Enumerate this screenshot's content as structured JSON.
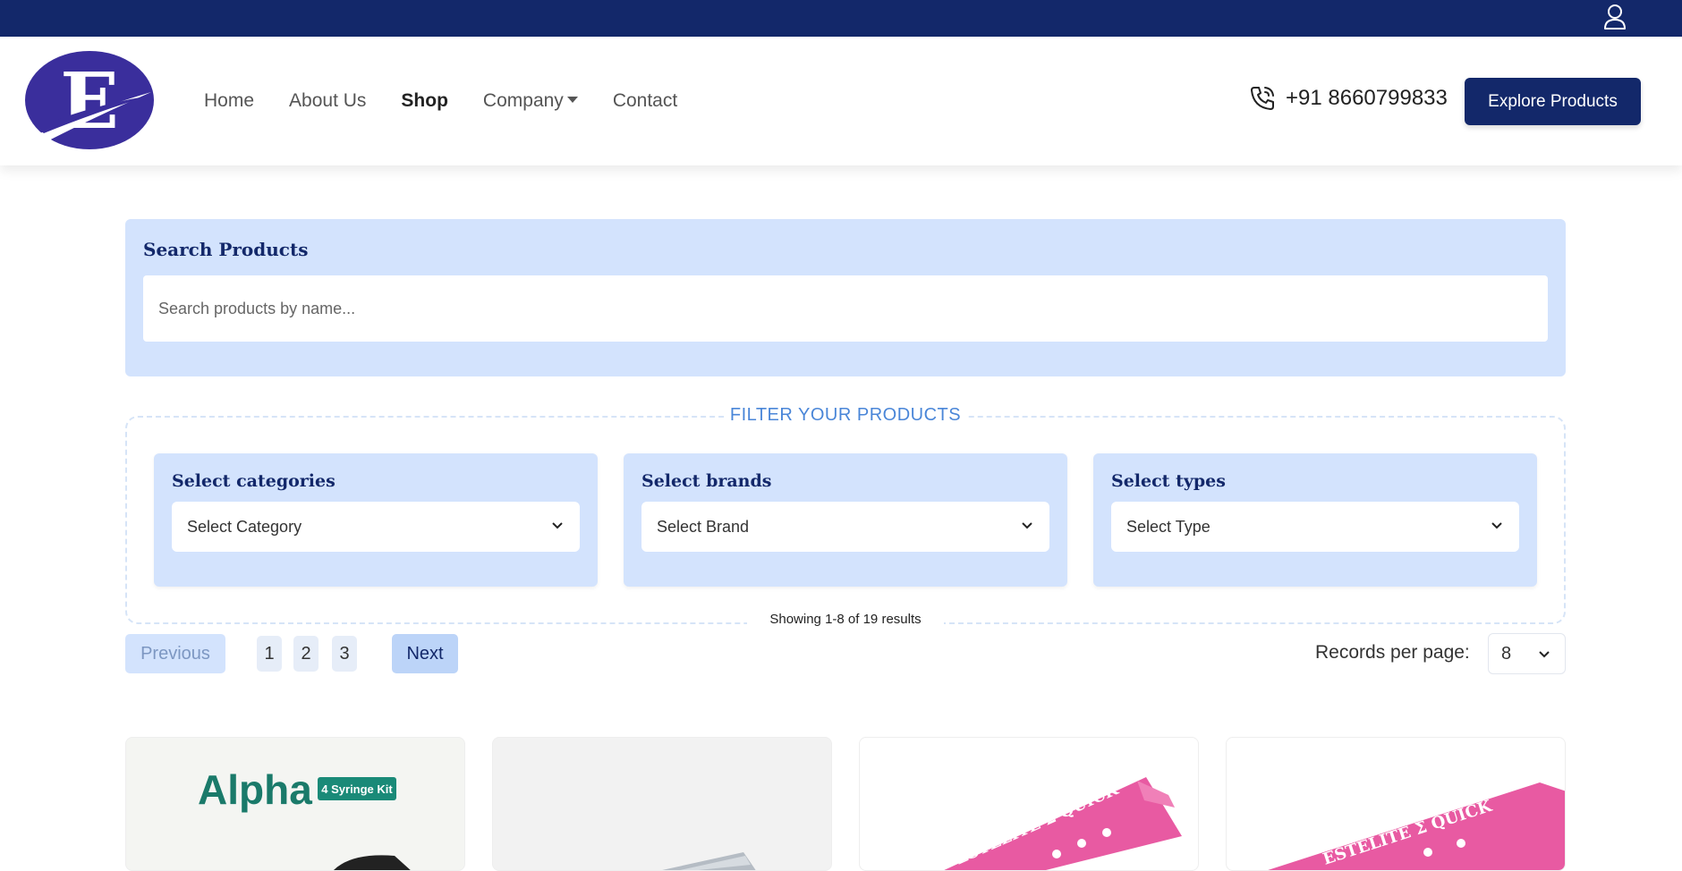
{
  "header": {
    "nav": [
      {
        "label": "Home"
      },
      {
        "label": "About Us"
      },
      {
        "label": "Shop",
        "active": true
      },
      {
        "label": "Company",
        "dropdown": true
      },
      {
        "label": "Contact"
      }
    ],
    "phone": "+91 8660799833",
    "explore_label": "Explore Products",
    "logo_letter": "E",
    "icons": {
      "user": "user-icon",
      "phone": "phone-icon",
      "logo": "brand-logo"
    }
  },
  "search": {
    "title": "Search Products",
    "placeholder": "Search products by name..."
  },
  "filters": {
    "heading": "FILTER YOUR PRODUCTS",
    "categories": {
      "label": "Select categories",
      "value": "Select Category"
    },
    "brands": {
      "label": "Select brands",
      "value": "Select Brand"
    },
    "types": {
      "label": "Select types",
      "value": "Select Type"
    },
    "showing": "Showing 1-8 of 19 results"
  },
  "pagination": {
    "previous": "Previous",
    "pages": [
      "1",
      "2",
      "3"
    ],
    "next": "Next",
    "records_label": "Records per page:",
    "records_value": "8"
  },
  "products": [
    {
      "brand_text": "Alpha",
      "badge_text": "4 Syringe Kit"
    },
    {},
    {
      "box_text": "ESTELITE Σ QUICK"
    },
    {
      "box_text": "ESTELITE Σ QUICK"
    }
  ],
  "colors": {
    "navy": "#13286a",
    "panel_blue": "#d3e3fd",
    "accent_blue": "#4a86d8",
    "product_pink": "#e85aa2"
  }
}
